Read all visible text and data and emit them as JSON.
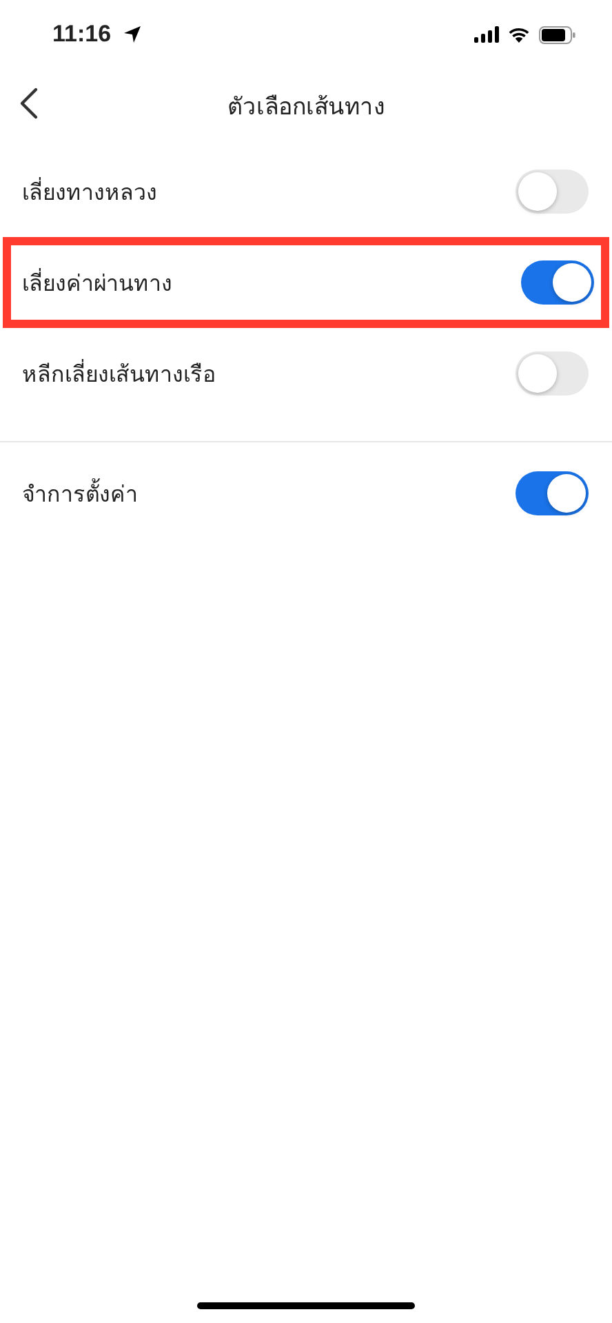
{
  "status_bar": {
    "time": "11:16"
  },
  "nav": {
    "title": "ตัวเลือกเส้นทาง"
  },
  "sections": [
    {
      "options": [
        {
          "label": "เลี่ยงทางหลวง",
          "on": false,
          "highlighted": false
        },
        {
          "label": "เลี่ยงค่าผ่านทาง",
          "on": true,
          "highlighted": true
        },
        {
          "label": "หลีกเลี่ยงเส้นทางเรือ",
          "on": false,
          "highlighted": false
        }
      ]
    },
    {
      "options": [
        {
          "label": "จำการตั้งค่า",
          "on": true,
          "highlighted": false
        }
      ]
    }
  ]
}
